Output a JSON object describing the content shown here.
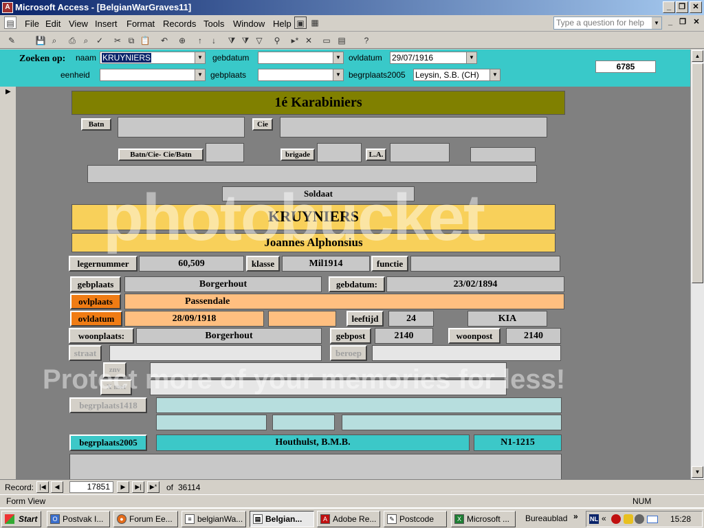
{
  "window": {
    "title": "Microsoft Access - [BelgianWarGraves11]"
  },
  "menu": [
    "File",
    "Edit",
    "View",
    "Insert",
    "Format",
    "Records",
    "Tools",
    "Window",
    "Help"
  ],
  "help_placeholder": "Type a question for help",
  "search": {
    "label": "Zoeken op:",
    "naam_label": "naam",
    "naam_value": "KRUYNIERS",
    "gebdatum_label": "gebdatum",
    "gebdatum_value": "",
    "ovldatum_label": "ovldatum",
    "ovldatum_value": "29/07/1916",
    "eenheid_label": "eenheid",
    "eenheid_value": "",
    "gebplaats_label": "gebplaats",
    "gebplaats_value": "",
    "begrplaats2005_label": "begrplaats2005",
    "begrplaats2005_value": "Leysin, S.B. (CH)",
    "count": "6785"
  },
  "record": {
    "unit": "1é Karabiniers",
    "batn_label": "Batn",
    "cie_label": "Cie",
    "batncie_label": "Batn/Cie- Cie/Batn",
    "brigade_label": "brigade",
    "la_label": "L.A.",
    "rank": "Soldaat",
    "surname": "KRUYNIERS",
    "firstnames": "Joannes Alphonsius",
    "legernummer_label": "legernummer",
    "legernummer": "60,509",
    "klasse_label": "klasse",
    "klasse": "Mil1914",
    "functie_label": "functie",
    "gebplaats_label": "gebplaats",
    "gebplaats": "Borgerhout",
    "gebdatum_label": "gebdatum:",
    "gebdatum": "23/02/1894",
    "ovlplaats_label": "ovlplaats",
    "ovlplaats": "Passendale",
    "ovldatum_label": "ovldatum",
    "ovldatum": "28/09/1918",
    "leeftijd_label": "leeftijd",
    "leeftijd": "24",
    "status": "KIA",
    "woonplaats_label": "woonplaats:",
    "woonplaats": "Borgerhout",
    "gebpost_label": "gebpost",
    "gebpost": "2140",
    "woonpost_label": "woonpost",
    "woonpost": "2140",
    "straat_label": "straat",
    "beroep_label": "beroep",
    "znv_label": "znv",
    "xmet_label": "X met",
    "begrplaats1418_label": "begrplaats1418",
    "begrplaats2005_label": "begrplaats2005",
    "begrplaats2005": "Houthulst, B.M.B.",
    "grave": "N1-1215"
  },
  "nav": {
    "record_label": "Record:",
    "current": "17851",
    "of_label": "of",
    "total": "36114"
  },
  "status": {
    "view": "Form View",
    "num": "NUM"
  },
  "taskbar": {
    "start": "Start",
    "tasks": [
      "Postvak I...",
      "Forum Ee...",
      "belgianWa...",
      "Belgian...",
      "Adobe Re...",
      "Postcode",
      "Microsoft ..."
    ],
    "bureaublad": "Bureaublad",
    "time": "15:28"
  },
  "watermark": {
    "logo": "photobucket",
    "tagline": "Protect more of your memories for less!"
  },
  "colors": {
    "form_header": "#39c9c9",
    "orange": "#f07c14",
    "gold": "#f8d05a",
    "olive": "#808000"
  }
}
